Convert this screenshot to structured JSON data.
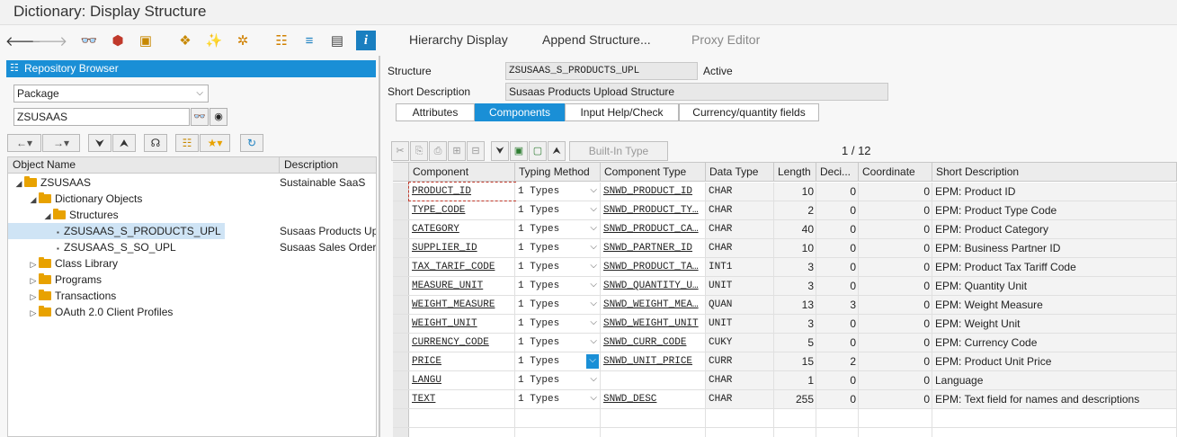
{
  "window": {
    "title": "Dictionary: Display Structure"
  },
  "toolbar": {
    "icons": [
      "back-arrow-icon",
      "forward-arrow-icon",
      "glasses-icon",
      "other-object-icon",
      "activate-icon",
      "where-used-icon",
      "magic-wand-icon",
      "navigate-icon",
      "hierarchy-icon",
      "stack-icon",
      "layout-icon",
      "info-icon"
    ],
    "hierarchy_display": "Hierarchy Display",
    "append_structure": "Append Structure...",
    "proxy_editor": "Proxy Editor"
  },
  "repository": {
    "header": "Repository Browser",
    "type_select": "Package",
    "package_value": "ZSUSAAS",
    "tree_headers": {
      "name": "Object Name",
      "description": "Description"
    },
    "tree": [
      {
        "label": "ZSUSAAS",
        "desc": "Sustainable SaaS",
        "level": 0,
        "kind": "folder",
        "expanded": true
      },
      {
        "label": "Dictionary Objects",
        "desc": "",
        "level": 1,
        "kind": "folder",
        "expanded": true
      },
      {
        "label": "Structures",
        "desc": "",
        "level": 2,
        "kind": "folder",
        "expanded": true
      },
      {
        "label": "ZSUSAAS_S_PRODUCTS_UPL",
        "desc": "Susaas Products Up",
        "level": 3,
        "kind": "leaf",
        "selected": true
      },
      {
        "label": "ZSUSAAS_S_SO_UPL",
        "desc": "Susaas Sales Order I",
        "level": 3,
        "kind": "leaf"
      },
      {
        "label": "Class Library",
        "desc": "",
        "level": 1,
        "kind": "folder",
        "expanded": false
      },
      {
        "label": "Programs",
        "desc": "",
        "level": 1,
        "kind": "folder",
        "expanded": false
      },
      {
        "label": "Transactions",
        "desc": "",
        "level": 1,
        "kind": "folder",
        "expanded": false
      },
      {
        "label": "OAuth 2.0 Client Profiles",
        "desc": "",
        "level": 1,
        "kind": "folder",
        "expanded": false
      }
    ]
  },
  "structure": {
    "label_structure": "Structure",
    "name": "ZSUSAAS_S_PRODUCTS_UPL",
    "status": "Active",
    "label_short_desc": "Short Description",
    "short_desc": "Susaas Products Upload Structure"
  },
  "tabs": [
    "Attributes",
    "Components",
    "Input Help/Check",
    "Currency/quantity fields"
  ],
  "active_tab": "Components",
  "table_toolbar": {
    "builtin_type": "Built-In Type",
    "pager": "1  /  12"
  },
  "grid": {
    "headers": [
      "Component",
      "Typing Method",
      "Component Type",
      "Data Type",
      "Length",
      "Deci...",
      "Coordinate",
      "Short Description"
    ],
    "rows": [
      {
        "component": "PRODUCT_ID",
        "typing": "1 Types",
        "ctype": "SNWD_PRODUCT_ID",
        "dtype": "CHAR",
        "length": "10",
        "dec": "0",
        "coord": "0",
        "desc": "EPM: Product ID"
      },
      {
        "component": "TYPE_CODE",
        "typing": "1 Types",
        "ctype": "SNWD_PRODUCT_TY…",
        "dtype": "CHAR",
        "length": "2",
        "dec": "0",
        "coord": "0",
        "desc": "EPM: Product Type Code"
      },
      {
        "component": "CATEGORY",
        "typing": "1 Types",
        "ctype": "SNWD_PRODUCT_CA…",
        "dtype": "CHAR",
        "length": "40",
        "dec": "0",
        "coord": "0",
        "desc": "EPM: Product Category"
      },
      {
        "component": "SUPPLIER_ID",
        "typing": "1 Types",
        "ctype": "SNWD_PARTNER_ID",
        "dtype": "CHAR",
        "length": "10",
        "dec": "0",
        "coord": "0",
        "desc": "EPM: Business Partner ID"
      },
      {
        "component": "TAX_TARIF_CODE",
        "typing": "1 Types",
        "ctype": "SNWD_PRODUCT_TA…",
        "dtype": "INT1",
        "length": "3",
        "dec": "0",
        "coord": "0",
        "desc": "EPM: Product Tax Tariff Code"
      },
      {
        "component": "MEASURE_UNIT",
        "typing": "1 Types",
        "ctype": "SNWD_QUANTITY_U…",
        "dtype": "UNIT",
        "length": "3",
        "dec": "0",
        "coord": "0",
        "desc": "EPM: Quantity Unit"
      },
      {
        "component": "WEIGHT_MEASURE",
        "typing": "1 Types",
        "ctype": "SNWD_WEIGHT_MEA…",
        "dtype": "QUAN",
        "length": "13",
        "dec": "3",
        "coord": "0",
        "desc": "EPM: Weight Measure"
      },
      {
        "component": "WEIGHT_UNIT",
        "typing": "1 Types",
        "ctype": "SNWD_WEIGHT_UNIT",
        "dtype": "UNIT",
        "length": "3",
        "dec": "0",
        "coord": "0",
        "desc": "EPM: Weight Unit"
      },
      {
        "component": "CURRENCY_CODE",
        "typing": "1 Types",
        "ctype": "SNWD_CURR_CODE",
        "dtype": "CUKY",
        "length": "5",
        "dec": "0",
        "coord": "0",
        "desc": "EPM: Currency Code"
      },
      {
        "component": "PRICE",
        "typing": "1 Types",
        "ctype": "SNWD_UNIT_PRICE",
        "dtype": "CURR",
        "length": "15",
        "dec": "2",
        "coord": "0",
        "desc": "EPM: Product Unit Price"
      },
      {
        "component": "LANGU",
        "typing": "1 Types",
        "ctype": "",
        "dtype": "CHAR",
        "length": "1",
        "dec": "0",
        "coord": "0",
        "desc": "Language"
      },
      {
        "component": "TEXT",
        "typing": "1 Types",
        "ctype": "SNWD_DESC",
        "dtype": "CHAR",
        "length": "255",
        "dec": "0",
        "coord": "0",
        "desc": "EPM: Text field for names and descriptions"
      }
    ]
  },
  "colors": {
    "accent": "#1a8fd6",
    "folder": "#e8a200",
    "selection": "#cfe4f5"
  }
}
